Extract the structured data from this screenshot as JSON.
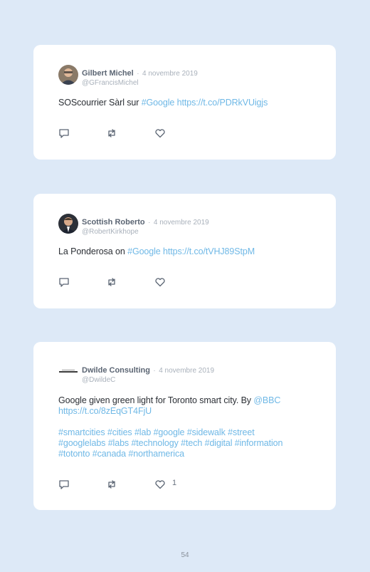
{
  "tweets": [
    {
      "name": "Gilbert Michel",
      "dot": "·",
      "date": "4 novembre 2019",
      "handle": "@GFrancisMichel",
      "text": "SOScourrier Sàrl sur ",
      "link1": "#Google",
      "link2": "https://t.co/PDRkVUigjs",
      "reply_icon": "reply-icon",
      "retweet_icon": "retweet-icon",
      "like_icon": "heart-icon"
    },
    {
      "name": "Scottish Roberto",
      "dot": "·",
      "date": "4 novembre 2019",
      "handle": "@RobertKirkhope",
      "text": "La Ponderosa on ",
      "link1": "#Google",
      "link2": "https://t.co/tVHJ89StpM",
      "reply_icon": "reply-icon",
      "retweet_icon": "retweet-icon",
      "like_icon": "heart-icon"
    },
    {
      "name": "Dwilde Consulting",
      "dot": "·",
      "date": "4 novembre 2019",
      "handle": "@DwildeC",
      "text": "Google given green light for Toronto smart city. By ",
      "mention": "@BBC",
      "link2": "https://t.co/8zEqGT4FjU",
      "hashtags_line1": "#smartcities #cities #lab #google #sidewalk #street",
      "hashtags_line2": "#googlelabs #labs #technology #tech #digital #information",
      "hashtags_line3": "#totonto #canada #northamerica",
      "like_count": "1",
      "reply_icon": "reply-icon",
      "retweet_icon": "retweet-icon",
      "like_icon": "heart-icon"
    }
  ],
  "page_number": "54",
  "colors": {
    "background": "#dde9f7",
    "link": "#6fb8e6",
    "card": "#ffffff"
  }
}
